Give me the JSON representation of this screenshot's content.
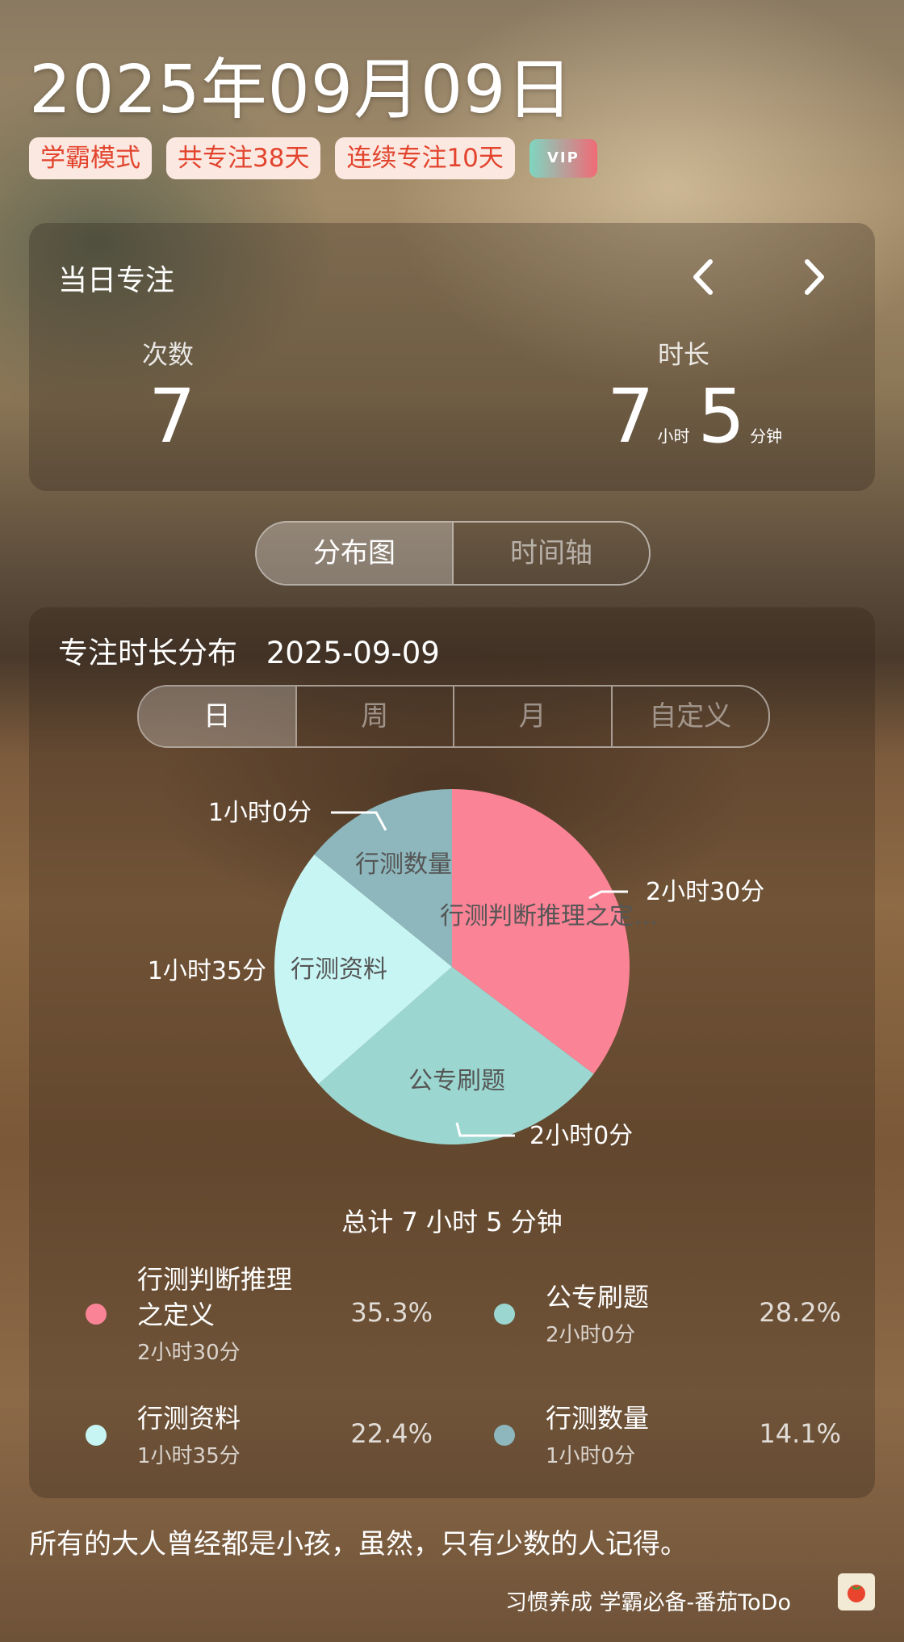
{
  "header": {
    "date": "2025年09月09日",
    "badges": [
      "学霸模式",
      "共专注38天",
      "连续专注10天"
    ],
    "vip": "VIP"
  },
  "daily": {
    "title": "当日专注",
    "prev": "‹",
    "next": "›",
    "count_label": "次数",
    "count": "7",
    "duration_label": "时长",
    "hours": "7",
    "hours_unit": "小时",
    "minutes": "5",
    "minutes_unit": "分钟"
  },
  "view_tabs": [
    "分布图",
    "时间轴"
  ],
  "distribution": {
    "title": "专注时长分布",
    "date": "2025-09-09",
    "period_tabs": [
      "日",
      "周",
      "月",
      "自定义"
    ],
    "total": "总计 7 小时 5 分钟"
  },
  "chart_data": {
    "type": "pie",
    "categories": [
      "行测判断推理之定义",
      "公专刷题",
      "行测资料",
      "行测数量"
    ],
    "values": [
      150,
      120,
      95,
      60
    ],
    "slice_labels": [
      "行测判断推理之定…",
      "公专刷题",
      "行测资料",
      "行测数量"
    ],
    "callouts": [
      "2小时30分",
      "2小时0分",
      "1小时35分",
      "1小时0分"
    ],
    "colors": [
      "#fb8396",
      "#9bd7d0",
      "#c7f5f4",
      "#8db7bd"
    ]
  },
  "legend": [
    {
      "name_line1": "行测判断推理",
      "name_line2": "之定义",
      "time": "2小时30分",
      "pct": "35.3%",
      "color": "#fb8396"
    },
    {
      "name_line1": "公专刷题",
      "name_line2": "",
      "time": "2小时0分",
      "pct": "28.2%",
      "color": "#9bd7d0"
    },
    {
      "name_line1": "行测资料",
      "name_line2": "",
      "time": "1小时35分",
      "pct": "22.4%",
      "color": "#c7f5f4"
    },
    {
      "name_line1": "行测数量",
      "name_line2": "",
      "time": "1小时0分",
      "pct": "14.1%",
      "color": "#8db7bd"
    }
  ],
  "footer": {
    "quote": "所有的大人曾经都是小孩，虽然，只有少数的人记得。",
    "brand": "习惯养成 学霸必备-番茄ToDo",
    "app_icon": "tomato-icon"
  }
}
